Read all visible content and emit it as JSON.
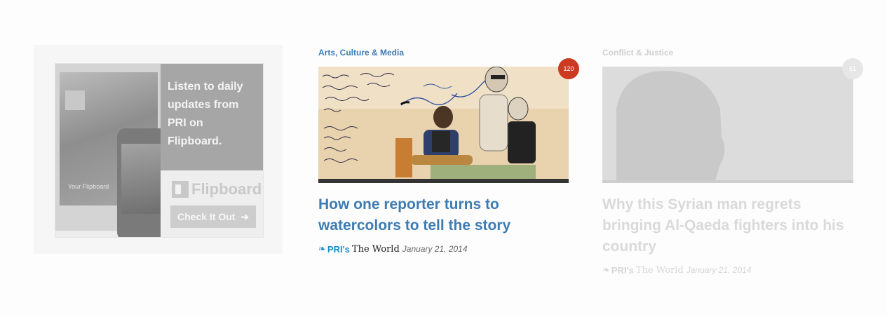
{
  "ad": {
    "banner_text": "Listen to daily updates from PRI on Flipboard.",
    "brand": "Flipboard",
    "cta_label": "Check It Out",
    "cta_arrow": "➜",
    "tablet_caption": "Your Flipboard"
  },
  "cards": [
    {
      "category": "Arts, Culture & Media",
      "comment_count": "120",
      "headline": "How one reporter turns to watercolors to tell the story",
      "source_icon": "❧",
      "source_brand": "PRI's",
      "source_show": "The World",
      "date": "January 21, 2014"
    },
    {
      "category": "Conflict & Justice",
      "comment_count": "51",
      "headline": "Why this Syrian man regrets bringing Al-Qaeda fighters into his country",
      "source_icon": "❧",
      "source_brand": "PRI's",
      "source_show": "The World",
      "date": "January 21, 2014"
    }
  ],
  "colors": {
    "accent": "#3d7bb3",
    "badge": "#cc3a22",
    "pri_blue": "#1a8ec9"
  }
}
